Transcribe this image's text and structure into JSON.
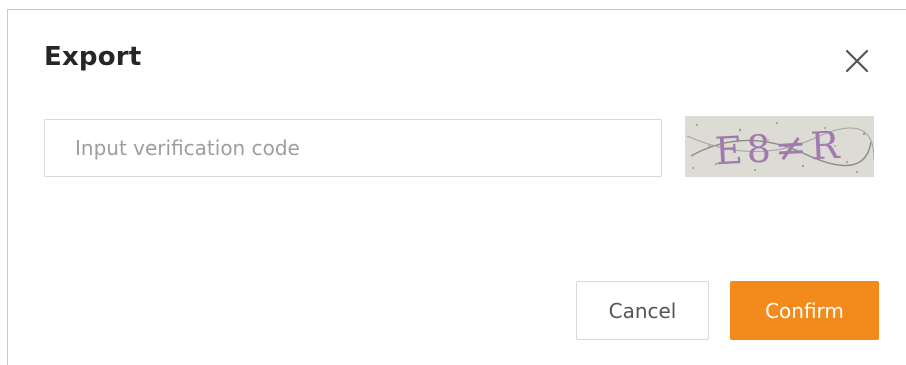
{
  "dialog": {
    "title": "Export",
    "close_icon": "close-icon"
  },
  "verification": {
    "placeholder": "Input verification code",
    "value": "",
    "captcha_text": "E8≠R"
  },
  "actions": {
    "cancel_label": "Cancel",
    "confirm_label": "Confirm"
  },
  "colors": {
    "accent": "#f28a1c",
    "border": "#d9d9d9",
    "frame_edge": "#a8d4e6"
  }
}
